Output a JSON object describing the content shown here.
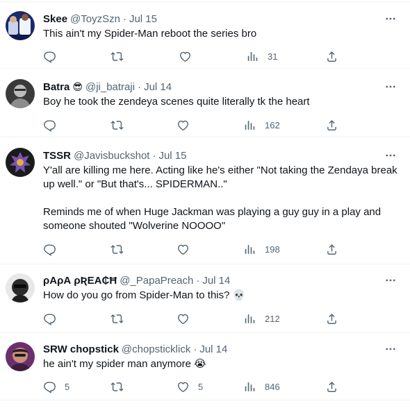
{
  "tweets": [
    {
      "name": "Skee",
      "handle": "@ToyzSzn",
      "separator": "·",
      "time": "Jul 15",
      "text": "This ain't my Spider-Man reboot the series bro",
      "reply_count": "",
      "retweet_count": "",
      "like_count": "",
      "views": "31"
    },
    {
      "name": "Batra",
      "name_emoji": "😎",
      "handle": "@ji_batraji",
      "separator": "·",
      "time": "Jul 14",
      "text": "Boy he took the zendeya scenes quite literally tk the heart",
      "reply_count": "",
      "retweet_count": "",
      "like_count": "",
      "views": "162"
    },
    {
      "name": "TSSR",
      "handle": "@Javisbuckshot",
      "separator": "·",
      "time": "Jul 15",
      "text": "Y'all are killing me here. Acting like he's either \"Not taking the Zendaya break up well.\" or \"But that's... SPIDERMAN..\"\n\nReminds me of when Huge Jackman was playing a guy guy in a play and someone shouted \"Wolverine NOOOO\"",
      "reply_count": "",
      "retweet_count": "",
      "like_count": "",
      "views": "198"
    },
    {
      "name": "ρΑρΑ ρƦΕΑ₵Ħ",
      "handle": "@_PapaPreach",
      "separator": "·",
      "time": "Jul 14",
      "text": "How do you go from Spider-Man to this? 💀",
      "reply_count": "",
      "retweet_count": "",
      "like_count": "",
      "views": "212"
    },
    {
      "name": "SRW chopstick",
      "handle": "@chopsticklick",
      "separator": "·",
      "time": "Jul 14",
      "text": "he ain't my spider man anymore 😭",
      "reply_count": "5",
      "retweet_count": "",
      "like_count": "5",
      "views": "846"
    }
  ],
  "icons": {
    "more": "more-horizontal-icon",
    "reply": "reply-icon",
    "retweet": "retweet-icon",
    "like": "like-heart-icon",
    "views": "views-chart-icon",
    "share": "share-icon"
  },
  "colors": {
    "text_primary": "#0f1419",
    "text_secondary": "#536471",
    "divider": "#eff3f4"
  }
}
